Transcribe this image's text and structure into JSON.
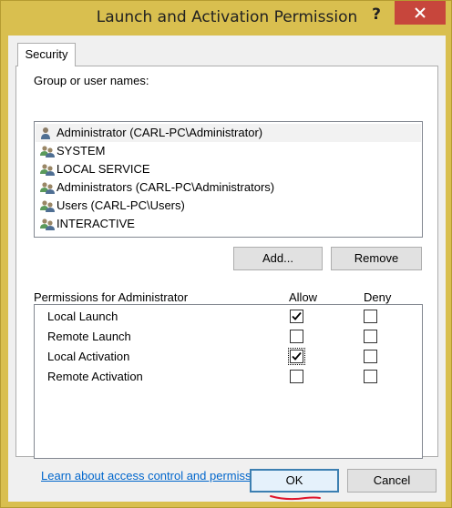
{
  "window": {
    "title": "Launch and Activation Permission",
    "help_label": "?"
  },
  "tabs": [
    {
      "label": "Security"
    }
  ],
  "users": {
    "label": "Group or user names:",
    "items": [
      {
        "name": "Administrator (CARL-PC\\Administrator)",
        "icon": "user-icon",
        "selected": true
      },
      {
        "name": "SYSTEM",
        "icon": "users-icon"
      },
      {
        "name": "LOCAL SERVICE",
        "icon": "users-icon"
      },
      {
        "name": "Administrators (CARL-PC\\Administrators)",
        "icon": "users-icon"
      },
      {
        "name": "Users (CARL-PC\\Users)",
        "icon": "users-icon"
      },
      {
        "name": "INTERACTIVE",
        "icon": "users-icon"
      }
    ],
    "add_label": "Add...",
    "remove_label": "Remove"
  },
  "permissions": {
    "label": "Permissions for Administrator",
    "allow_header": "Allow",
    "deny_header": "Deny",
    "rows": [
      {
        "name": "Local Launch",
        "allow": true,
        "deny": false
      },
      {
        "name": "Remote Launch",
        "allow": false,
        "deny": false
      },
      {
        "name": "Local Activation",
        "allow": true,
        "deny": false
      },
      {
        "name": "Remote Activation",
        "allow": false,
        "deny": false
      }
    ]
  },
  "link_text": "Learn about access control and permissions",
  "footer": {
    "ok_label": "OK",
    "cancel_label": "Cancel"
  },
  "colors": {
    "title_bar": "#d9bf4f",
    "close_button": "#c7463c",
    "link": "#0066cc",
    "annotation": "#e0142a"
  }
}
